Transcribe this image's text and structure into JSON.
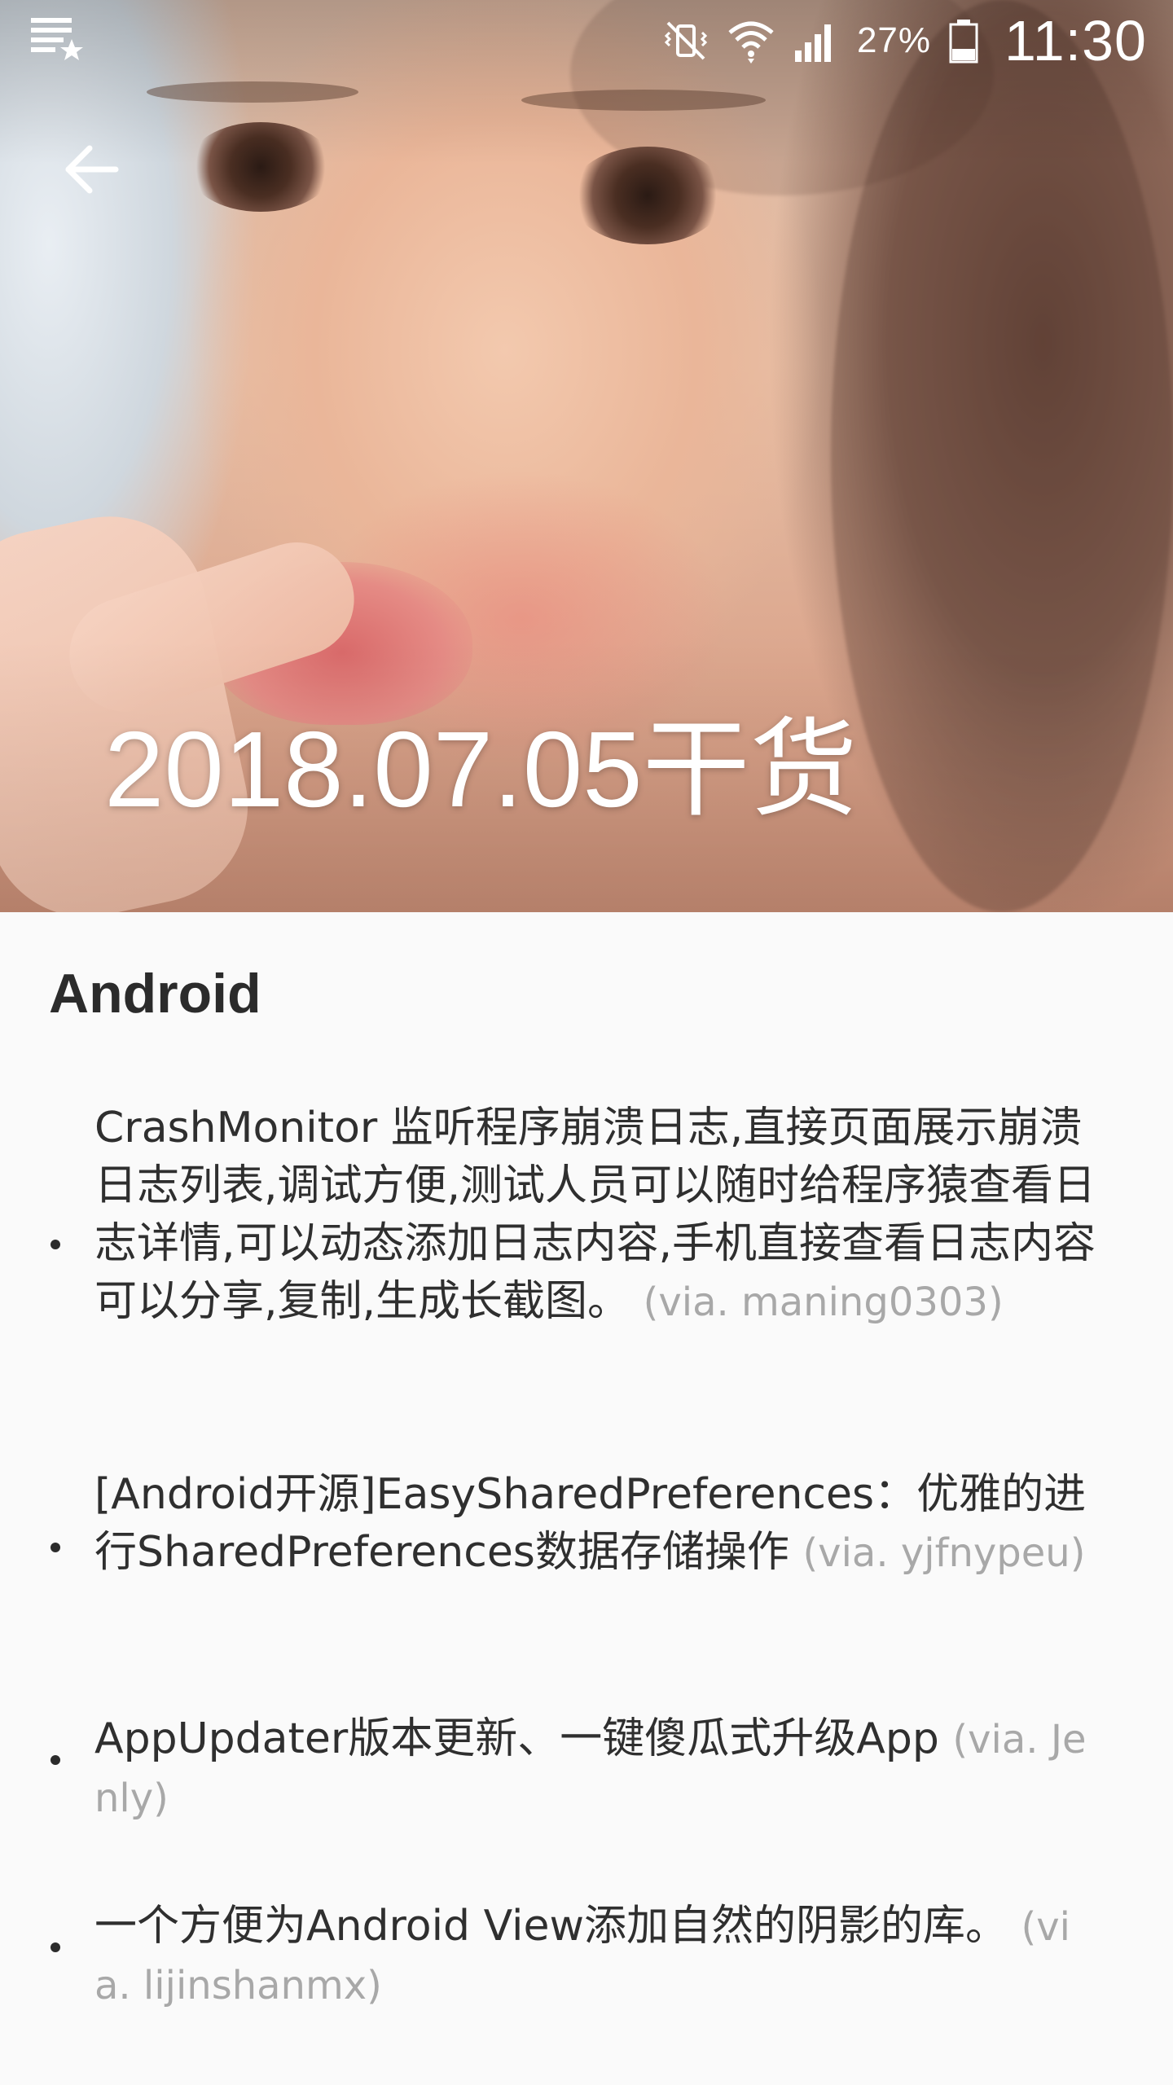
{
  "status_bar": {
    "battery_percent": "27%",
    "time": "11:30",
    "icons": [
      "notification-icon",
      "vibrate-mute-icon",
      "wifi-icon",
      "signal-icon",
      "battery-icon"
    ]
  },
  "header": {
    "back_icon": "arrow-left-icon",
    "title": "2018.07.05干货"
  },
  "section": {
    "heading": "Android",
    "items": [
      {
        "text": "CrashMonitor 监听程序崩溃日志,直接页面展示崩溃日志列表,调试方便,测试人员可以随时给程序猿查看日志详情,可以动态添加日志内容,手机直接查看日志内容可以分享,复制,生成长截图。",
        "via": "(via. maning0303)"
      },
      {
        "text": "[Android开源]EasySharedPreferences：优雅的进行SharedPreferences数据存储操作",
        "via": "(via. yjfnypeu)"
      },
      {
        "text": "AppUpdater版本更新、一键傻瓜式升级App",
        "via": "(via. Jenly)"
      },
      {
        "text": "一个方便为Android View添加自然的阴影的库。",
        "via": "(via. lijinshanmx)"
      }
    ]
  },
  "colors": {
    "background": "#fafafa",
    "text": "#2f2f2f",
    "via_text": "#a8a8a8",
    "title_text": "#ffffff"
  }
}
